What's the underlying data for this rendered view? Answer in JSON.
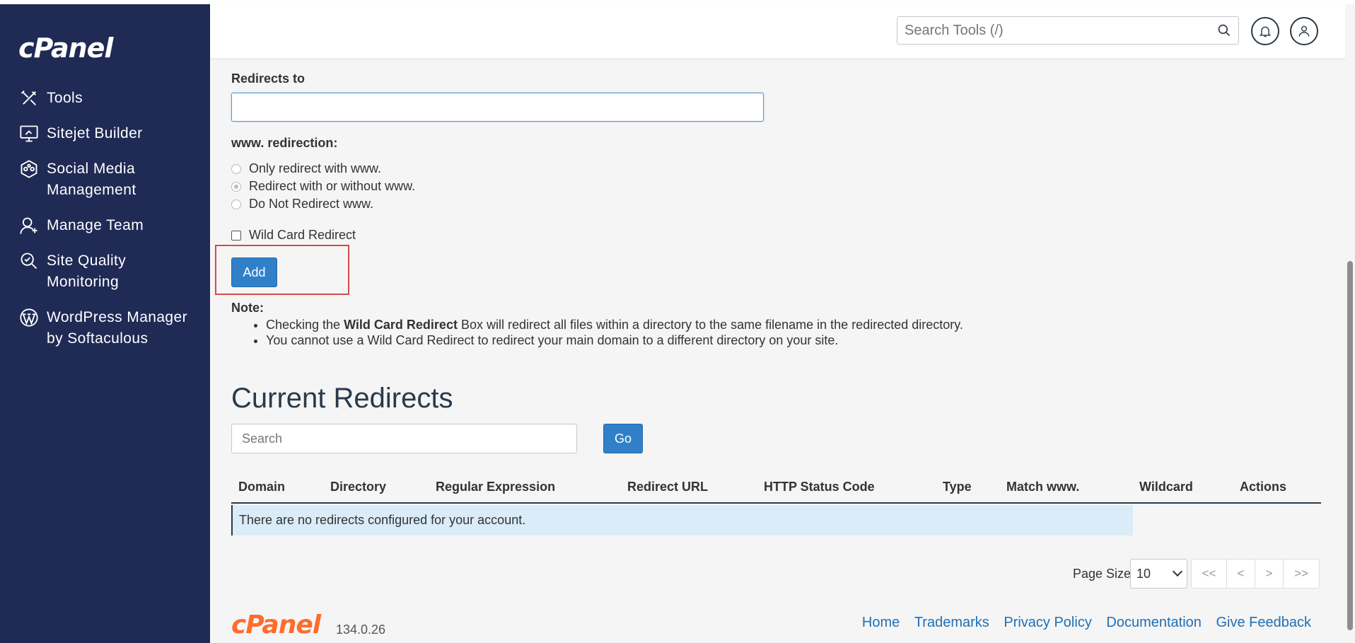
{
  "app": {
    "logo": "cPanel",
    "version": "134.0.26"
  },
  "sidebar": {
    "items": [
      {
        "label": "Tools"
      },
      {
        "label": "Sitejet Builder"
      },
      {
        "label": "Social Media Management"
      },
      {
        "label": "Manage Team"
      },
      {
        "label": "Site Quality Monitoring"
      },
      {
        "label": "WordPress Manager by Softaculous"
      }
    ]
  },
  "header": {
    "search_placeholder": "Search Tools (/)"
  },
  "form": {
    "redirects_to_label": "Redirects to",
    "redirects_to_value": "",
    "www_label": "www. redirection:",
    "www_options": [
      {
        "label": "Only redirect with www.",
        "checked": false
      },
      {
        "label": "Redirect with or without www.",
        "checked": true
      },
      {
        "label": "Do Not Redirect www.",
        "checked": false
      }
    ],
    "wildcard_label": "Wild Card Redirect",
    "add_label": "Add"
  },
  "note": {
    "title": "Note:",
    "line1_prefix": "Checking the ",
    "line1_bold": "Wild Card Redirect",
    "line1_suffix": " Box will redirect all files within a directory to the same filename in the redirected directory.",
    "line2": "You cannot use a Wild Card Redirect to redirect your main domain to a different directory on your site."
  },
  "current": {
    "title": "Current Redirects",
    "search_placeholder": "Search",
    "go_label": "Go",
    "columns": [
      "Domain",
      "Directory",
      "Regular Expression",
      "Redirect URL",
      "HTTP Status Code",
      "Type",
      "Match www.",
      "Wildcard",
      "Actions"
    ],
    "empty_message": "There are no redirects configured for your account."
  },
  "pagination": {
    "page_size_label": "Page Size",
    "page_size_value": "10",
    "first": "<<",
    "prev": "<",
    "next": ">",
    "last": ">>"
  },
  "footer": {
    "links": [
      "Home",
      "Trademarks",
      "Privacy Policy",
      "Documentation",
      "Give Feedback"
    ]
  },
  "colors": {
    "sidebar": "#1f2a55",
    "primary": "#2f80c9",
    "brand_orange": "#ff6c2c",
    "highlight": "#d24b4b"
  }
}
